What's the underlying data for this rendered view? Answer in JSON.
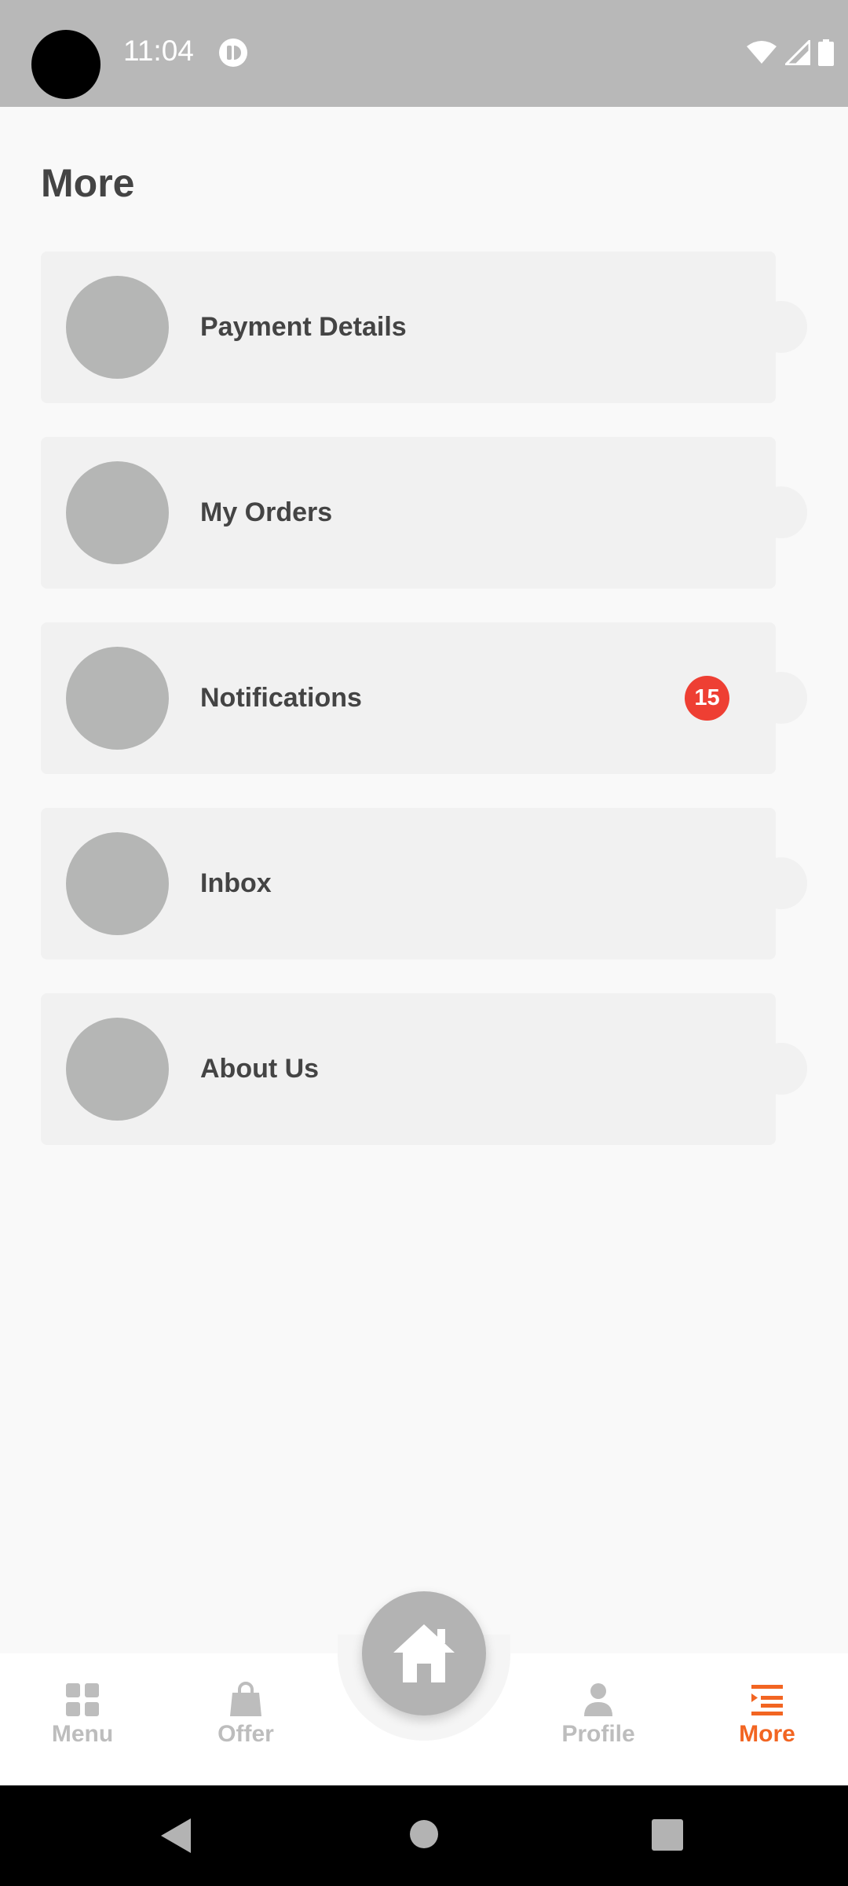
{
  "status_bar": {
    "time": "11:04"
  },
  "page": {
    "title": "More"
  },
  "menu": {
    "items": [
      {
        "label": "Payment Details",
        "badge": ""
      },
      {
        "label": "My Orders",
        "badge": ""
      },
      {
        "label": "Notifications",
        "badge": "15"
      },
      {
        "label": "Inbox",
        "badge": ""
      },
      {
        "label": "About Us",
        "badge": ""
      }
    ]
  },
  "bottom_nav": {
    "menu_label": "Menu",
    "offer_label": "Offer",
    "profile_label": "Profile",
    "more_label": "More",
    "active": "More"
  },
  "colors": {
    "accent": "#f26522",
    "badge": "#ee3f33",
    "status_bar": "#b8b8b8"
  }
}
